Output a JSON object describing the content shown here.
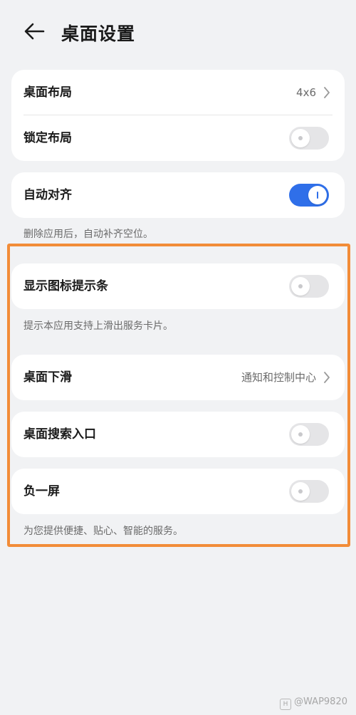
{
  "header": {
    "title": "桌面设置"
  },
  "group1": {
    "layout_label": "桌面布局",
    "layout_value": "4x6",
    "lock_label": "锁定布局",
    "lock_on": false
  },
  "group2": {
    "align_label": "自动对齐",
    "align_on": true,
    "align_hint": "删除应用后，自动补齐空位。"
  },
  "group3": {
    "badge_label": "显示图标提示条",
    "badge_on": false,
    "badge_hint": "提示本应用支持上滑出服务卡片。"
  },
  "group4": {
    "swipe_label": "桌面下滑",
    "swipe_value": "通知和控制中心"
  },
  "group5": {
    "search_label": "桌面搜索入口",
    "search_on": false
  },
  "group6": {
    "minus_label": "负一屏",
    "minus_on": false,
    "minus_hint": "为您提供便捷、贴心、智能的服务。"
  },
  "watermark": {
    "text": "@WAP9820"
  },
  "colors": {
    "accent": "#2f6fe9",
    "highlight": "#f28c38",
    "background": "#f1f2f4"
  }
}
